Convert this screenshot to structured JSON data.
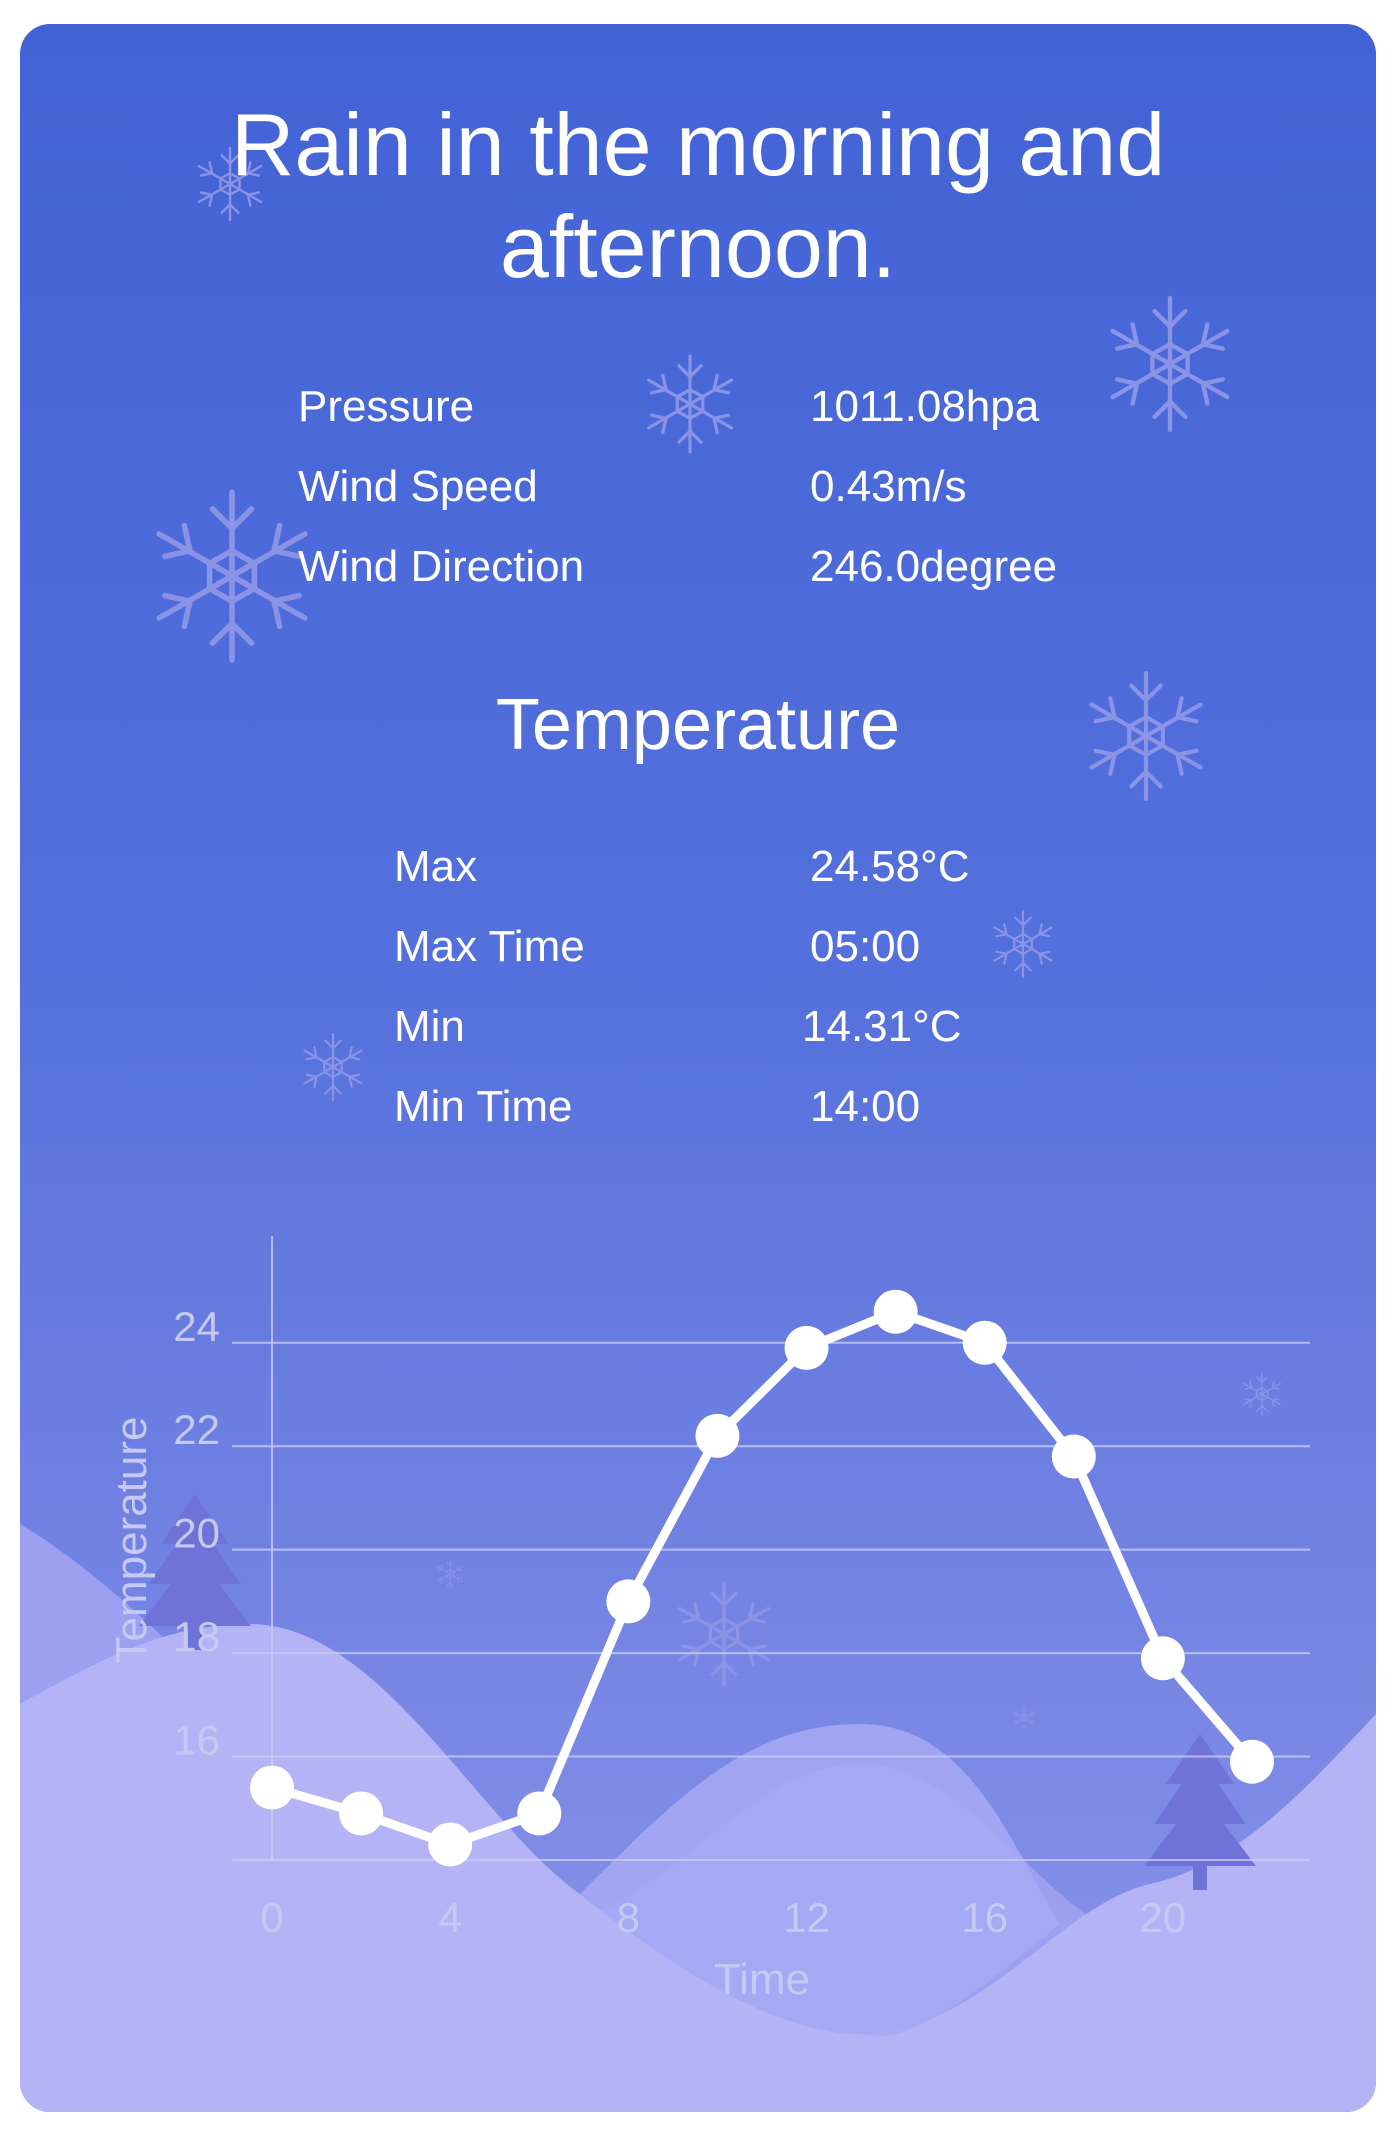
{
  "summary": "Rain in the morning and afternoon.",
  "details": [
    {
      "label": "Pressure",
      "value": "1011.08hpa"
    },
    {
      "label": "Wind Speed",
      "value": "0.43m/s"
    },
    {
      "label": "Wind Direction",
      "value": "246.0degree"
    }
  ],
  "temperature_section": {
    "title": "Temperature",
    "rows": [
      {
        "label": "Max",
        "value": "24.58°C"
      },
      {
        "label": "Max Time",
        "value": "05:00"
      },
      {
        "label": "Min",
        "value": "14.31°C"
      },
      {
        "label": "Min Time",
        "value": "14:00"
      }
    ]
  },
  "colors": {
    "background_top": "#4263d6",
    "background_bottom": "#8b95ea",
    "line": "#ffffff",
    "hill_front": "#b3b3f6",
    "hill_back": "#9d9ff0"
  },
  "icons": [
    "snowflake-icon",
    "tree-icon"
  ],
  "chart_data": {
    "type": "line",
    "xlabel": "Time",
    "ylabel": "Temperature",
    "xticks": [
      0,
      4,
      8,
      12,
      16,
      20
    ],
    "yticks": [
      16,
      18,
      20,
      22,
      24
    ],
    "xlim": [
      0,
      22
    ],
    "ylim": [
      14,
      25.6
    ],
    "grid": true,
    "series": [
      {
        "x": [
          0,
          2,
          4,
          6,
          8,
          10,
          12,
          14,
          16,
          18,
          20,
          22
        ],
        "values": [
          15.4,
          14.9,
          14.3,
          14.9,
          19.0,
          22.2,
          23.9,
          24.6,
          24.0,
          21.8,
          17.9,
          15.9
        ]
      }
    ]
  }
}
